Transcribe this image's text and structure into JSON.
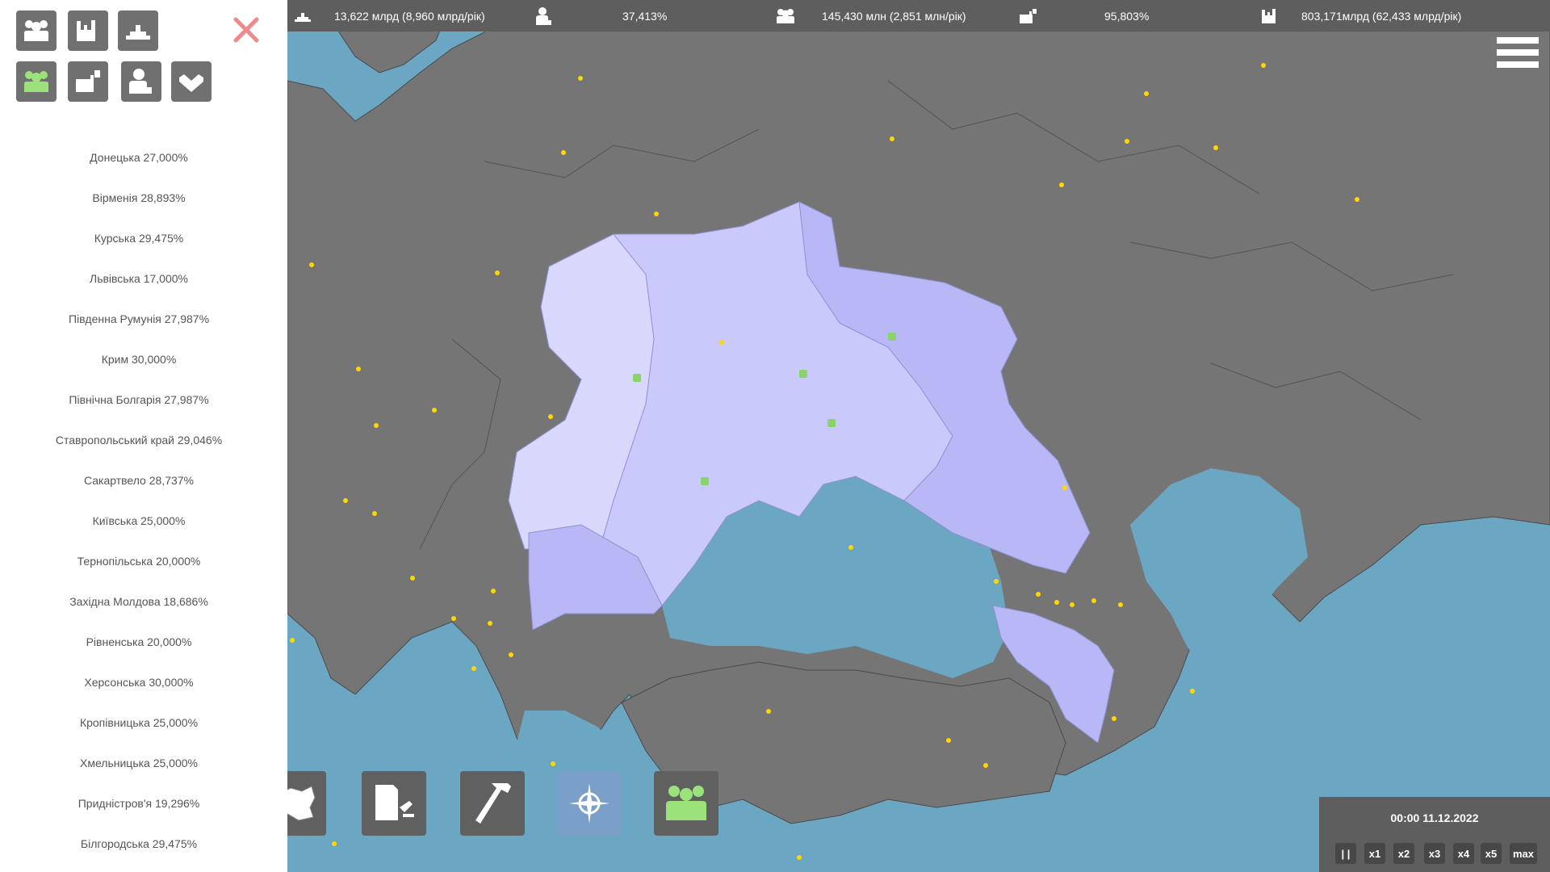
{
  "left_panel": {
    "categories": [
      {
        "icon": "population-icon",
        "active": false
      },
      {
        "icon": "factory-icon",
        "active": false
      },
      {
        "icon": "resources-icon",
        "active": false
      },
      {
        "icon": "people-icon",
        "active": true
      },
      {
        "icon": "briefcase-icon",
        "active": false
      },
      {
        "icon": "worker-icon",
        "active": false
      },
      {
        "icon": "handshake-icon",
        "active": false
      }
    ],
    "regions": [
      "Донецька 27,000%",
      "Вірменія 28,893%",
      "Курська 29,475%",
      "Львівська 17,000%",
      "Південна Румунія 27,987%",
      "Крим 30,000%",
      "Північна Болгарія 27,987%",
      "Ставропольський край 29,046%",
      "Сакартвело 28,737%",
      "Київська 25,000%",
      "Тернопільська 20,000%",
      "Західна Молдова 18,686%",
      "Рівненська 20,000%",
      "Херсонська 30,000%",
      "Кропівницька 25,000%",
      "Хмельницька 25,000%",
      "Придністров'я 19,296%",
      "Білгородська 29,475%"
    ]
  },
  "stats_bar": {
    "resources": "13,622 млрд (8,960 млрд/рік)",
    "employment": "37,413%",
    "population": "145,430 млн (2,851 млн/рік)",
    "business": "95,803%",
    "industry": "803,171млрд (62,433 млрд/рік)"
  },
  "time_panel": {
    "clock": "00:00 11.12.2022",
    "speeds": [
      "| |",
      "x1",
      "x2",
      "x3",
      "x4",
      "x5",
      "max"
    ]
  },
  "tools": [
    {
      "icon": "regions-map-icon"
    },
    {
      "icon": "documents-law-icon"
    },
    {
      "icon": "hammer-icon"
    },
    {
      "icon": "nato-compass-icon"
    },
    {
      "icon": "people-group-icon"
    }
  ],
  "colors": {
    "sea": "#6ba7c3",
    "land": "#757575",
    "borders": "#4a4a4a",
    "player_light": "#d3d3fb",
    "player_mid": "#bdbdf8",
    "player_dark": "#aeaef4",
    "star": "#ffd700",
    "active_icon": "#9be27a",
    "close": "#ee8a8a"
  }
}
